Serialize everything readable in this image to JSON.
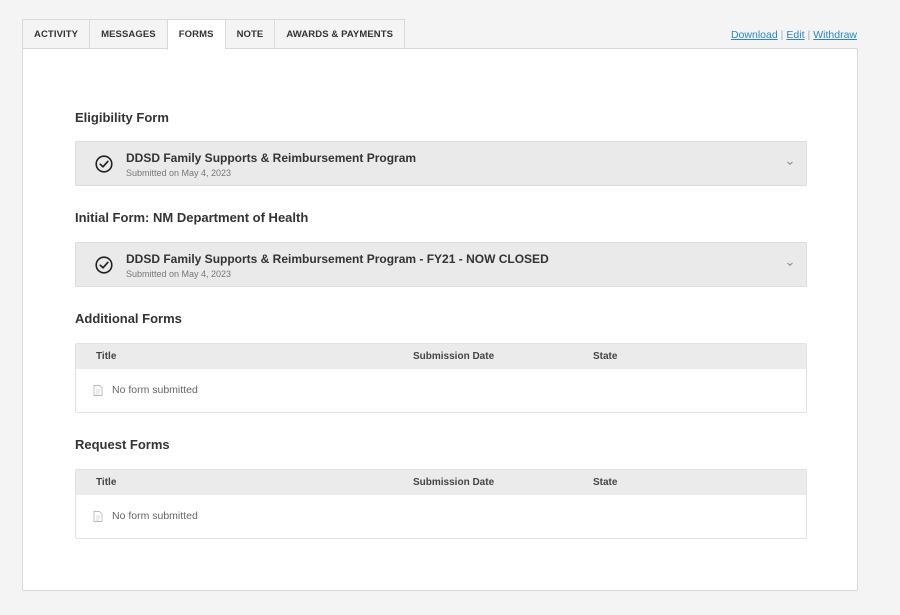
{
  "tabs": [
    {
      "label": "ACTIVITY"
    },
    {
      "label": "MESSAGES"
    },
    {
      "label": "FORMS"
    },
    {
      "label": "NOTE"
    },
    {
      "label": "AWARDS & PAYMENTS"
    }
  ],
  "active_tab": "FORMS",
  "actions": {
    "download": "Download",
    "edit": "Edit",
    "withdraw": "Withdraw",
    "separator": "|"
  },
  "eligibility": {
    "title": "Eligibility Form",
    "form_name": "DDSD Family Supports & Reimbursement Program",
    "submitted": "Submitted on May 4, 2023"
  },
  "initial": {
    "title": "Initial Form: NM Department of Health",
    "form_name": "DDSD Family Supports & Reimbursement Program - FY21 - NOW CLOSED",
    "submitted": "Submitted on May 4, 2023"
  },
  "additional": {
    "title": "Additional Forms",
    "columns": [
      "Title",
      "Submission Date",
      "State"
    ],
    "empty_text": "No form submitted"
  },
  "request": {
    "title": "Request Forms",
    "columns": [
      "Title",
      "Submission Date",
      "State"
    ],
    "empty_text": "No form submitted"
  },
  "colors": {
    "link": "#2a86c5",
    "card_bg": "#eaeaea",
    "header_bg": "#ebebeb"
  },
  "icons": {
    "check": "check-circle-icon",
    "chevron": "chevron-down-icon",
    "document": "document-icon"
  }
}
